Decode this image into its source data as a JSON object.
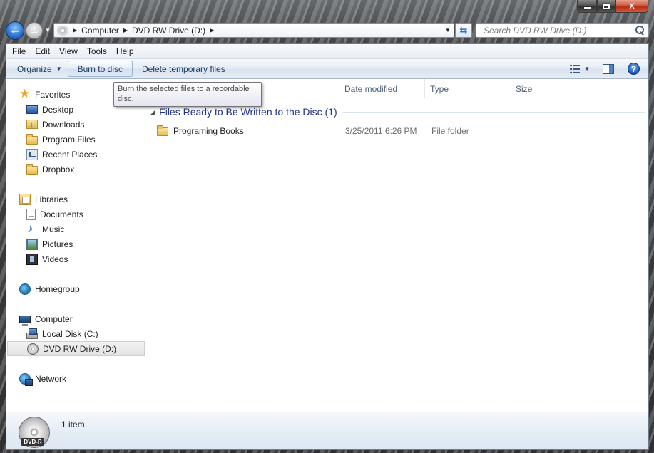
{
  "window": {
    "minimize_glyph": "",
    "close_glyph": "X"
  },
  "address": {
    "crumbs": [
      "Computer",
      "DVD RW Drive (D:)"
    ]
  },
  "search": {
    "placeholder": "Search DVD RW Drive (D:)"
  },
  "menubar": {
    "items": [
      "File",
      "Edit",
      "View",
      "Tools",
      "Help"
    ]
  },
  "toolbar": {
    "organize_label": "Organize",
    "burn_label": "Burn to disc",
    "delete_temp_label": "Delete temporary files",
    "help_glyph": "?"
  },
  "tooltip": {
    "text": "Burn the selected files to a recordable disc."
  },
  "nav": {
    "favorites": {
      "label": "Favorites",
      "items": [
        "Desktop",
        "Downloads",
        "Program Files",
        "Recent Places",
        "Dropbox"
      ]
    },
    "libraries": {
      "label": "Libraries",
      "items": [
        "Documents",
        "Music",
        "Pictures",
        "Videos"
      ]
    },
    "homegroup": {
      "label": "Homegroup"
    },
    "computer": {
      "label": "Computer",
      "items": [
        "Local Disk (C:)",
        "DVD RW Drive (D:)"
      ]
    },
    "network": {
      "label": "Network"
    }
  },
  "columns": {
    "date": "Date modified",
    "type": "Type",
    "size": "Size"
  },
  "group": {
    "title": "Files Ready to Be Written to the Disc (1)"
  },
  "files": [
    {
      "name": "Programing Books",
      "date": "3/25/2011 6:26 PM",
      "type": "File folder"
    }
  ],
  "details": {
    "drive_label": "DVD-R",
    "count": "1 item"
  },
  "colors": {
    "accent": "#1e3287",
    "toolbar_text": "#1e3a63",
    "selection_bg": "#e3e3e3"
  }
}
